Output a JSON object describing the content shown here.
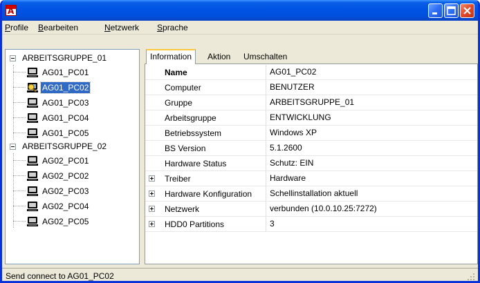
{
  "window": {
    "title": "",
    "accent": "#0054e3",
    "app_icon_letter": "A"
  },
  "menubar": {
    "items": [
      {
        "label": "Profile"
      },
      {
        "label": "Bearbeiten"
      },
      {
        "label": "Netzwerk"
      },
      {
        "label": "Sprache"
      }
    ]
  },
  "tree": {
    "groups": [
      {
        "name": "ARBEITSGRUPPE_01",
        "expanded": true,
        "children": [
          "AG01_PC01",
          "AG01_PC02",
          "AG01_PC03",
          "AG01_PC04",
          "AG01_PC05"
        ]
      },
      {
        "name": "ARBEITSGRUPPE_02",
        "expanded": true,
        "children": [
          "AG02_PC01",
          "AG02_PC02",
          "AG02_PC03",
          "AG02_PC04",
          "AG02_PC05"
        ]
      }
    ],
    "selected": "AG01_PC02"
  },
  "tabs": [
    {
      "label": "Information",
      "active": true
    },
    {
      "label": "Aktion",
      "active": false
    },
    {
      "label": "Umschalten",
      "active": false
    }
  ],
  "properties": [
    {
      "name": "Name",
      "value": "AG01_PC02",
      "bold": true,
      "expandable": false
    },
    {
      "name": "Computer",
      "value": "BENUTZER",
      "bold": false,
      "expandable": false
    },
    {
      "name": "Gruppe",
      "value": "ARBEITSGRUPPE_01",
      "bold": false,
      "expandable": false
    },
    {
      "name": "Arbeitsgruppe",
      "value": "ENTWICKLUNG",
      "bold": false,
      "expandable": false
    },
    {
      "name": "Betriebssystem",
      "value": "Windows XP",
      "bold": false,
      "expandable": false
    },
    {
      "name": "BS Version",
      "value": "5.1.2600",
      "bold": false,
      "expandable": false
    },
    {
      "name": "Hardware Status",
      "value": "Schutz: EIN",
      "bold": false,
      "expandable": false
    },
    {
      "name": "Treiber",
      "value": "Hardware",
      "bold": false,
      "expandable": true
    },
    {
      "name": "Hardware Konfiguration",
      "value": "Schellinstallation  aktuell",
      "bold": false,
      "expandable": true
    },
    {
      "name": "Netzwerk",
      "value": "verbunden (10.0.10.25:7272)",
      "bold": false,
      "expandable": true
    },
    {
      "name": "HDD0 Partitions",
      "value": "3",
      "bold": false,
      "expandable": true
    }
  ],
  "statusbar": {
    "text": "Send connect to AG01_PC02"
  },
  "colors": {
    "selection": "#316ac5",
    "tab_highlight": "#ffc73c",
    "close_button": "#e0492a"
  }
}
